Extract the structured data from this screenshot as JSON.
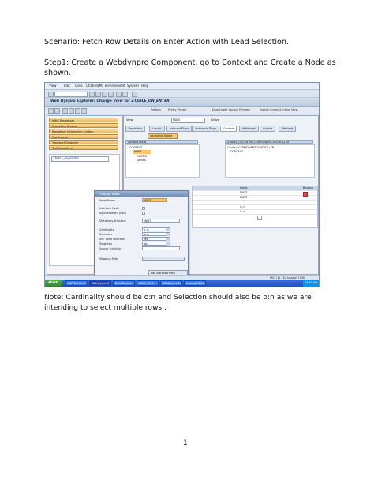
{
  "document": {
    "title": "Scenario: Fetch Row Details on Enter Action with Lead Selection.",
    "step1": "Step1:  Create a Webdynpro Component, go to Context and Create a Node as shown.",
    "note": "Note: Cardinality should be o:n and Selection should also be o:n as we are intending to select multiple rows .",
    "page_number": "1"
  },
  "screenshot": {
    "menu": [
      "View",
      "Edit",
      "Goto",
      "Utilities(M)",
      "Environment",
      "System",
      "Help"
    ],
    "window_title": "Web Dynpro Explorer: Change View for ZTABLE_ON_ENTER",
    "toolbar_labels": [
      "Pattern",
      "Pretty Printer",
      "Deactivate Layout Preview",
      "Switch Context Editor View"
    ],
    "repo_buttons": [
      "MIME Repository",
      "Repository Browser",
      "Repository Information System",
      "Tag Browser",
      "Transport Organizer",
      "Test Repository"
    ],
    "left_object": "ZTABLE_ON_ENTER",
    "view_label": "View",
    "view_value": "MAIN",
    "view_status": "Active",
    "tabs": [
      "Properties",
      "Layout",
      "Inbound Plugs",
      "Outbound Plugs",
      "Context",
      "Attributes",
      "Actions",
      "Methods"
    ],
    "active_tab": "Context",
    "controller_usage": "Controller Usage",
    "context_view_head": "Context MAIN",
    "context_view_items": [
      "CONTEXT",
      "MAKT",
      "MATNR",
      "SPRAS"
    ],
    "context_comp_head": "ZTABLE_ON_ENTER.COMPONENTCONTROLLER",
    "context_comp_sub": "Context COMPONENTCONTROLLER",
    "context_comp_items": [
      "CONTEXT"
    ],
    "grid_head_value": "Value",
    "grid_head_binding": "Binding",
    "grid_values": [
      "MAKT",
      "MAKT",
      "",
      "0..n",
      "0..n"
    ],
    "dialog": {
      "title": "Change Node",
      "fields": [
        {
          "label": "Node Name",
          "value": "MAKT",
          "type": "text"
        },
        {
          "label": "Interface Node",
          "value": "",
          "type": "check"
        },
        {
          "label": "Input Element (Ext.)",
          "value": "",
          "type": "check"
        },
        {
          "label": "Dictionary structure",
          "value": "MAKT",
          "type": "text"
        },
        {
          "label": "Cardinality",
          "value": "0..n",
          "type": "select"
        },
        {
          "label": "Selection",
          "value": "0..n",
          "type": "select"
        },
        {
          "label": "Init. Lead Selection",
          "value": "Yes",
          "type": "select"
        },
        {
          "label": "Singleton",
          "value": "No",
          "type": "select"
        },
        {
          "label": "Supply Function",
          "value": "",
          "type": "text"
        },
        {
          "label": "Mapping Path",
          "value": "",
          "type": "text"
        }
      ],
      "add_button": "Add Attribute from Structure"
    },
    "status_text": "HD3 (1) 110  hlsapu37  INS",
    "taskbar": {
      "start": "start",
      "items": [
        "SAP Technical",
        "Web Dynpro E",
        "Data Browser",
        "ZABC_SN_2",
        "WebDynpro Ex",
        "Locking Objects"
      ],
      "clock": "10:49 AM"
    },
    "colors": {
      "highlight": "#ffc46a",
      "repo_button": "#f0c878",
      "taskbar": "#2a63c8",
      "title_bar": "#c7d6e8"
    }
  }
}
